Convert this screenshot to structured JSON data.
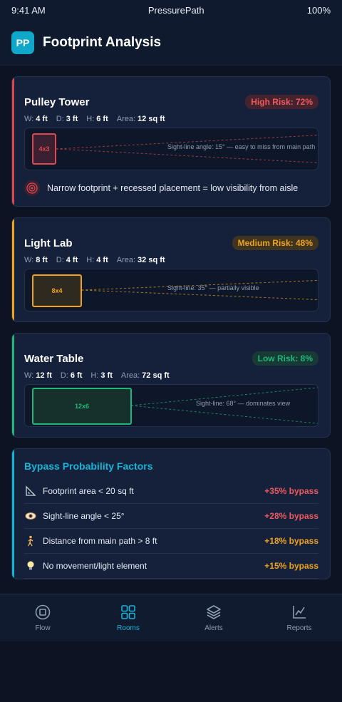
{
  "status": {
    "time": "9:41 AM",
    "app": "PressurePath",
    "battery": "100%"
  },
  "header": {
    "logo": "PP",
    "title": "Footprint Analysis"
  },
  "rooms": [
    {
      "name": "Pulley Tower",
      "risk_label": "High Risk: 72%",
      "risk_percent": 72,
      "accent": "#e0484f",
      "badge_bg": "#45232e",
      "dims": {
        "w_label": "W:",
        "w": "4 ft",
        "d_label": "D:",
        "d": "3 ft",
        "h_label": "H:",
        "h": "6 ft",
        "area_label": "Area:",
        "area": "12 sq ft"
      },
      "box_label": "4x3",
      "box_fill": "#3a2030",
      "sight_text": "Sight-line angle: 15° — easy to miss from main path",
      "note": "Narrow footprint + recessed placement = low visibility from aisle"
    },
    {
      "name": "Light Lab",
      "risk_label": "Medium Risk: 48%",
      "risk_percent": 48,
      "accent": "#f1a31c",
      "badge_bg": "#3e3420",
      "dims": {
        "w_label": "W:",
        "w": "8 ft",
        "d_label": "D:",
        "d": "4 ft",
        "h_label": "H:",
        "h": "4 ft",
        "area_label": "Area:",
        "area": "32 sq ft"
      },
      "box_label": "8x4",
      "box_fill": "#2f2a1f",
      "sight_text": "Sight-line: 35° — partially visible"
    },
    {
      "name": "Water Table",
      "risk_label": "Low Risk: 8%",
      "risk_percent": 8,
      "accent": "#21b67a",
      "badge_bg": "#173a34",
      "dims": {
        "w_label": "W:",
        "w": "12 ft",
        "d_label": "D:",
        "d": "6 ft",
        "h_label": "H:",
        "h": "3 ft",
        "area_label": "Area:",
        "area": "72 sq ft"
      },
      "box_label": "12x6",
      "box_fill": "#16302c",
      "sight_text": "Sight-line: 68° — dominates view"
    }
  ],
  "factors": {
    "title": "Bypass Probability Factors",
    "items": [
      {
        "icon": "triangle-ruler-icon",
        "label": "Footprint area < 20 sq ft",
        "value": "+35% bypass",
        "color": "#f05a5f"
      },
      {
        "icon": "eye-icon",
        "label": "Sight-line angle < 25°",
        "value": "+28% bypass",
        "color": "#f05a5f"
      },
      {
        "icon": "walking-person-icon",
        "label": "Distance from main path > 8 ft",
        "value": "+18% bypass",
        "color": "#f1a31c"
      },
      {
        "icon": "light-bulb-icon",
        "label": "No movement/light element",
        "value": "+15% bypass",
        "color": "#f1a31c"
      }
    ]
  },
  "nav": [
    {
      "label": "Flow",
      "icon": "stop-circle-icon",
      "active": false
    },
    {
      "label": "Rooms",
      "icon": "grid-icon",
      "active": true
    },
    {
      "label": "Alerts",
      "icon": "layers-icon",
      "active": false
    },
    {
      "label": "Reports",
      "icon": "line-chart-icon",
      "active": false
    }
  ],
  "colors": {
    "accent": "#16b5d8",
    "background": "#0c1424",
    "card": "#15213a"
  }
}
